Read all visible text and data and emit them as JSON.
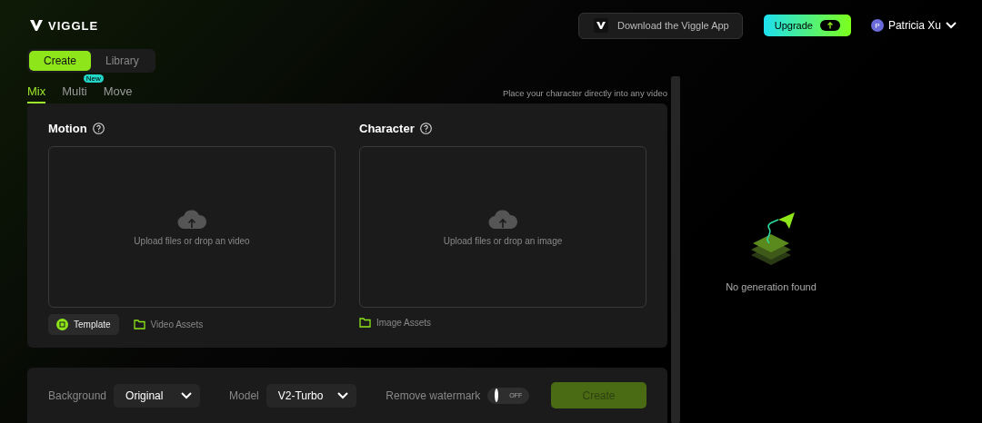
{
  "brand": {
    "name": "VIGGLE"
  },
  "header": {
    "download_button": "Download the Viggle App",
    "upgrade_button": "Upgrade",
    "user": {
      "initial": "P",
      "name": "Patricia Xu"
    }
  },
  "mode_tabs": [
    {
      "label": "Create",
      "selected": true
    },
    {
      "label": "Library",
      "selected": false
    }
  ],
  "sub_tabs": [
    {
      "label": "Mix",
      "selected": true
    },
    {
      "label": "Multi",
      "selected": false,
      "badge": "New"
    },
    {
      "label": "Move",
      "selected": false
    }
  ],
  "hint": "Place your character directly into any video",
  "upload_sections": [
    {
      "title": "Motion",
      "drop_text": "Upload files or drop an video",
      "actions": [
        {
          "label": "Template",
          "kind": "template"
        },
        {
          "label": "Video Assets",
          "kind": "folder"
        }
      ]
    },
    {
      "title": "Character",
      "drop_text": "Upload files or drop an image",
      "actions": [
        {
          "label": "Image Assets",
          "kind": "folder"
        }
      ]
    }
  ],
  "settings": {
    "background": {
      "label": "Background",
      "value": "Original"
    },
    "model": {
      "label": "Model",
      "value": "V2-Turbo"
    },
    "watermark": {
      "label": "Remove watermark",
      "on": false,
      "state_text": "OFF"
    },
    "create_button": {
      "label": "Create",
      "disabled": true
    }
  },
  "empty_state": {
    "text": "No generation found"
  }
}
